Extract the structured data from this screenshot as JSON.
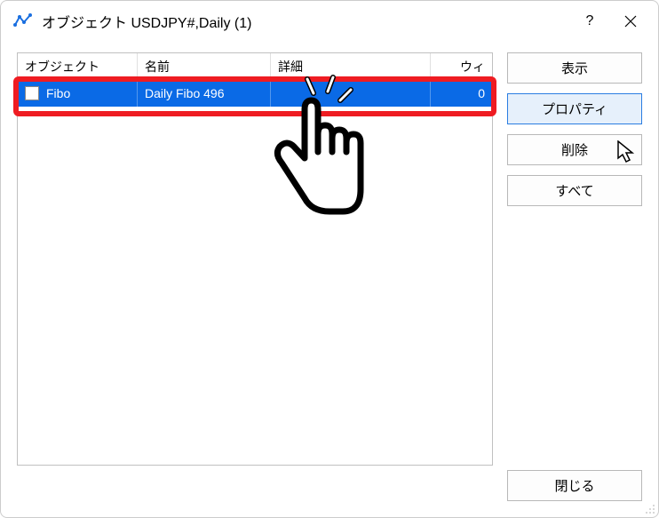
{
  "window": {
    "title": "オブジェクト USDJPY#,Daily (1)",
    "help": "?",
    "close": "×"
  },
  "table": {
    "headers": {
      "object": "オブジェクト",
      "name": "名前",
      "detail": "詳細",
      "window": "ウィ"
    },
    "row": {
      "object": "Fibo",
      "name": "Daily Fibo 496",
      "detail": "",
      "window": "0"
    }
  },
  "buttons": {
    "show": "表示",
    "properties": "プロパティ",
    "delete": "削除",
    "all": "すべて",
    "close": "閉じる"
  }
}
